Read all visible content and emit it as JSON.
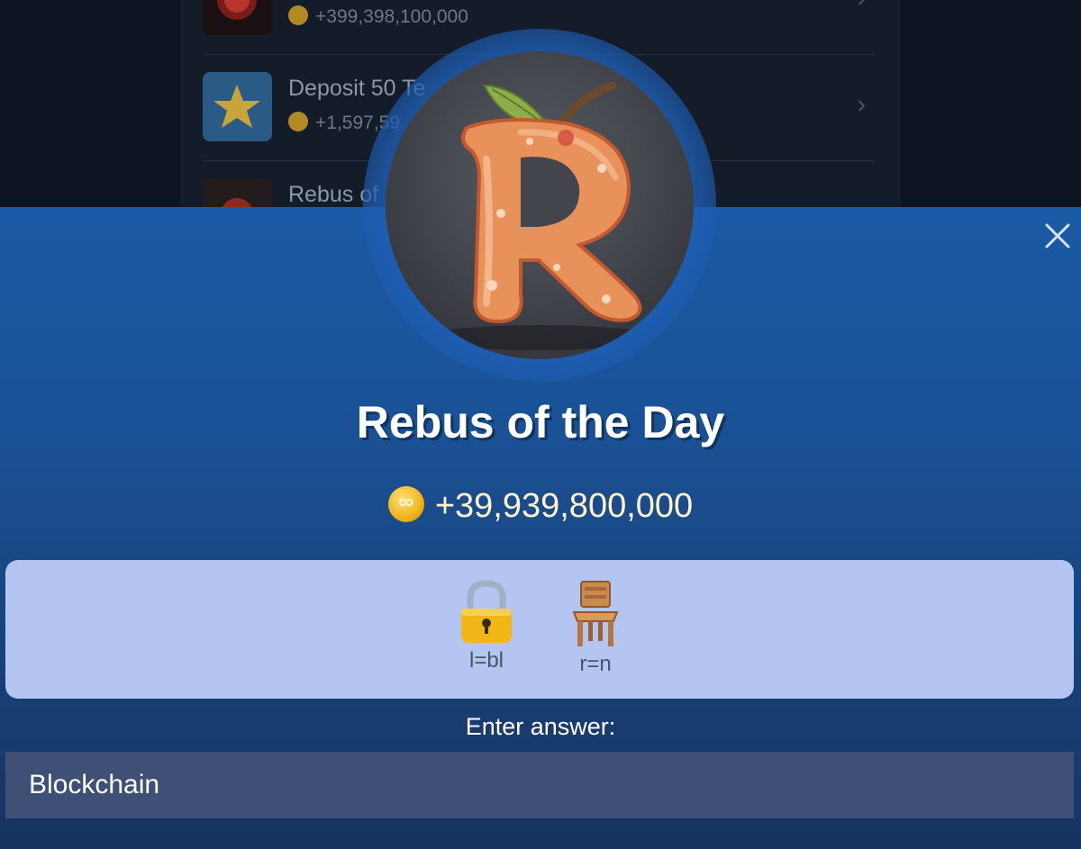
{
  "background_list": {
    "items": [
      {
        "title": "",
        "reward": "+399,398,100,000"
      },
      {
        "title": "Deposit 50 Te",
        "reward": "+1,597,59"
      },
      {
        "title": "Rebus of",
        "reward": ""
      }
    ]
  },
  "modal": {
    "title": "Rebus of the Day",
    "reward": "+39,939,800,000",
    "puzzle": {
      "items": [
        {
          "icon": "lock-icon",
          "caption": "l=bl"
        },
        {
          "icon": "chair-icon",
          "caption": "r=n"
        }
      ]
    },
    "answer_label": "Enter answer:",
    "answer_value": "Blockchain",
    "answer_placeholder": ""
  },
  "colors": {
    "modal_top": "#1b5aa6",
    "modal_bottom": "#17335f",
    "puzzle_bg": "#b3c5f0",
    "input_bg": "#3f5077",
    "coin": "#f0b418"
  }
}
